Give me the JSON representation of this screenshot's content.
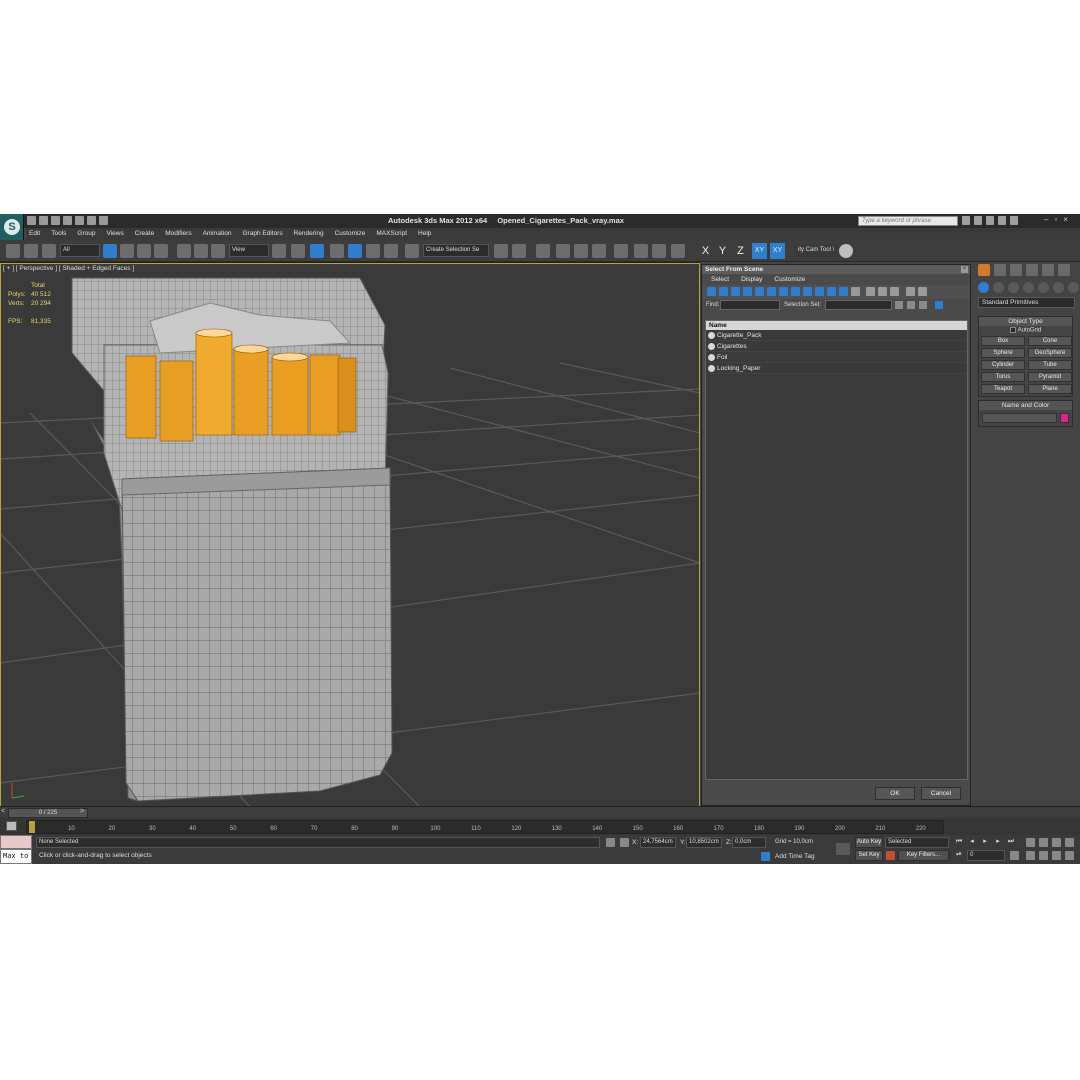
{
  "window": {
    "app_title": "Autodesk 3ds Max  2012 x64",
    "file_title": "Opened_Cigarettes_Pack_vray.max",
    "search_placeholder": "Type a keyword or phrase"
  },
  "menu": [
    "Edit",
    "Tools",
    "Group",
    "Views",
    "Create",
    "Modifiers",
    "Animation",
    "Graph Editors",
    "Rendering",
    "Customize",
    "MAXScript",
    "Help"
  ],
  "toolbar": {
    "filter": "All",
    "ref_coord": "View",
    "selection_set": "Create Selection Se",
    "axes": [
      "X",
      "Y",
      "Z",
      "XY",
      "XY"
    ],
    "cam_tool": "ity Cam Tool \\"
  },
  "viewport": {
    "label": "[ + ] [ Perspective ] [ Shaded + Edged Faces ]",
    "stats": {
      "total_label": "Total",
      "polys_label": "Polys:",
      "polys": "40 512",
      "verts_label": "Verts:",
      "verts": "20 294",
      "fps_label": "FPS:",
      "fps": "81,335"
    }
  },
  "dialog": {
    "title": "Select From Scene",
    "menu": [
      "Select",
      "Display",
      "Customize"
    ],
    "find_label": "Find:",
    "selection_set_label": "Selection Set:",
    "column": "Name",
    "objects": [
      "Cigarette_Pack",
      "Cigarettes",
      "Foil",
      "Locking_Paper"
    ],
    "ok": "OK",
    "cancel": "Cancel"
  },
  "command_panel": {
    "category": "Standard Primitives",
    "object_type_label": "Object Type",
    "autogrid": "AutoGrid",
    "primitives": [
      "Box",
      "Cone",
      "Sphere",
      "GeoSphere",
      "Cylinder",
      "Tube",
      "Torus",
      "Pyramid",
      "Teapot",
      "Plane"
    ],
    "name_color_label": "Name and Color",
    "object_color": "#e0238a"
  },
  "timeline": {
    "frame_display": "0 / 225",
    "ticks": [
      "10",
      "20",
      "30",
      "40",
      "50",
      "60",
      "70",
      "80",
      "90",
      "100",
      "110",
      "120",
      "130",
      "140",
      "150",
      "160",
      "170",
      "180",
      "190",
      "200",
      "210",
      "220"
    ]
  },
  "status": {
    "maxscript": "Max to",
    "selection": "None Selected",
    "prompt": "Click or click-and-drag to select objects",
    "x_label": "X:",
    "x": "24,7564cm",
    "y_label": "Y:",
    "y": "10,8502cm",
    "z_label": "Z:",
    "z": "0,0cm",
    "grid": "Grid = 10,0cm",
    "add_time_tag": "Add Time Tag",
    "auto_key": "Auto Key",
    "selected": "Selected",
    "set_key": "Set Key",
    "key_filters": "Key Filters...",
    "frame": "0"
  }
}
